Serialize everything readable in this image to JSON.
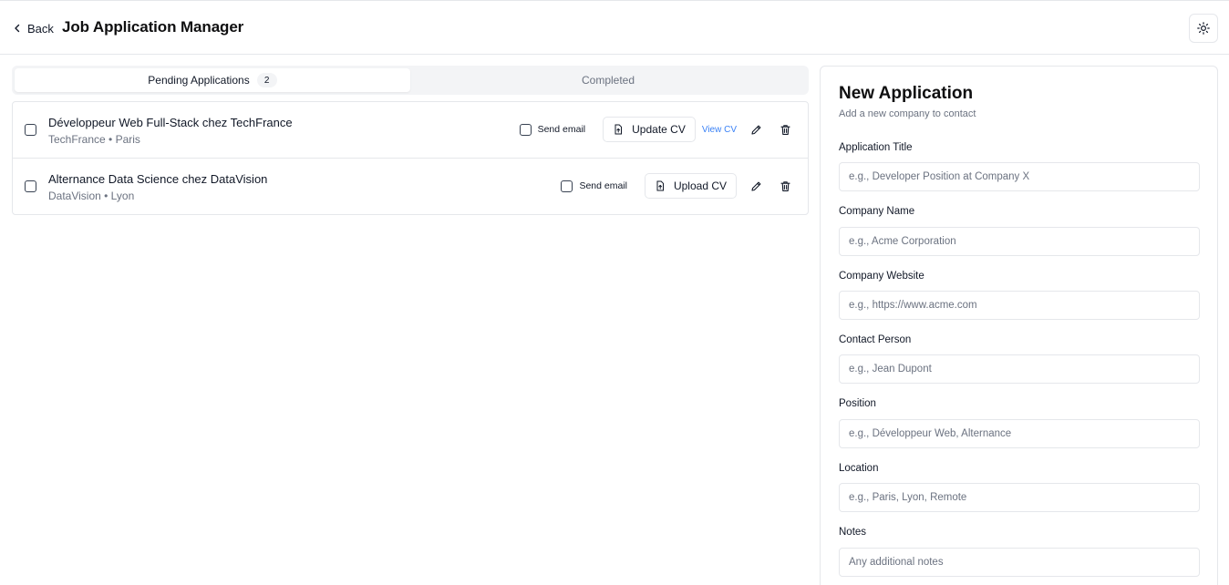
{
  "header": {
    "back_label": "Back",
    "title": "Job Application Manager",
    "theme_icon": "sun-icon"
  },
  "tabs": [
    {
      "label": "Pending Applications",
      "count": "2",
      "active": true
    },
    {
      "label": "Completed",
      "active": false
    }
  ],
  "applications": [
    {
      "title": "Développeur Web Full-Stack chez TechFrance",
      "subtitle": "TechFrance • Paris",
      "send_email_label": "Send email",
      "cv_button_label": "Update CV",
      "view_cv_label": "View CV"
    },
    {
      "title": "Alternance Data Science chez DataVision",
      "subtitle": "DataVision • Lyon",
      "send_email_label": "Send email",
      "cv_button_label": "Upload CV"
    }
  ],
  "form": {
    "title": "New Application",
    "subtitle": "Add a new company to contact",
    "fields": [
      {
        "label": "Application Title",
        "placeholder": "e.g., Developer Position at Company X"
      },
      {
        "label": "Company Name",
        "placeholder": "e.g., Acme Corporation"
      },
      {
        "label": "Company Website",
        "placeholder": "e.g., https://www.acme.com"
      },
      {
        "label": "Contact Person",
        "placeholder": "e.g., Jean Dupont"
      },
      {
        "label": "Position",
        "placeholder": "e.g., Développeur Web, Alternance"
      },
      {
        "label": "Location",
        "placeholder": "e.g., Paris, Lyon, Remote"
      },
      {
        "label": "Notes",
        "placeholder": "Any additional notes"
      }
    ]
  },
  "colors": {
    "accent_link": "#3b82f6",
    "border": "#e5e7eb",
    "muted_text": "#6b7280"
  }
}
